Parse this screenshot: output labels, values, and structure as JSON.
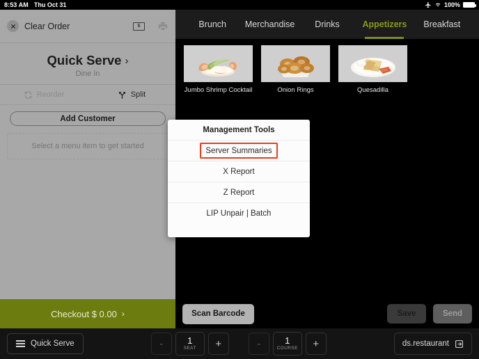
{
  "statusbar": {
    "time": "8:53 AM",
    "date": "Thu Oct 31",
    "battery_pct": "100%",
    "airplane_icon": "airplane-icon",
    "wifi_icon": "wifi-icon",
    "battery_icon": "battery-icon"
  },
  "order_panel": {
    "clear_order_label": "Clear Order",
    "close_icon": "close-x-icon",
    "cash_icon_label": "$",
    "cash_icon": "cash-drawer-icon",
    "print_icon": "printer-icon",
    "title": "Quick Serve",
    "title_chevron": "›",
    "subtitle": "Dine In",
    "reorder_label": "Reorder",
    "reorder_icon": "reorder-refresh-icon",
    "split_label": "Split",
    "split_icon": "split-branch-icon",
    "add_customer_label": "Add Customer",
    "empty_state": "Select a menu item to get started",
    "checkout_label": "Checkout $ 0.00",
    "checkout_chevron": "›",
    "checkout_color": "#6d7c0e"
  },
  "tabs": {
    "accent_color": "#8a9a16",
    "items": [
      {
        "label": "Brunch",
        "active": false
      },
      {
        "label": "Merchandise",
        "active": false
      },
      {
        "label": "Drinks",
        "active": false
      },
      {
        "label": "Appetizers",
        "active": true
      },
      {
        "label": "Breakfast",
        "active": false
      }
    ]
  },
  "menu_items": [
    {
      "label": "Jumbo Shrimp Cocktail",
      "image": "shrimp-cocktail-photo"
    },
    {
      "label": "Onion Rings",
      "image": "onion-rings-photo"
    },
    {
      "label": "Quesadilla",
      "image": "quesadilla-photo"
    }
  ],
  "modal": {
    "header": "Management Tools",
    "highlight_color": "#ea3c18",
    "items": [
      {
        "label": "Server Summaries",
        "selected": true
      },
      {
        "label": "X Report",
        "selected": false
      },
      {
        "label": "Z Report",
        "selected": false
      },
      {
        "label": "LIP Unpair | Batch",
        "selected": false
      }
    ]
  },
  "action_bar": {
    "scan_label": "Scan Barcode",
    "save_label": "Save",
    "send_label": "Send"
  },
  "bottom_bar": {
    "menu_icon": "hamburger-menu-icon",
    "order_type": "Quick Serve",
    "seat": {
      "minus": "-",
      "value": "1",
      "unit": "SEAT",
      "plus": "+"
    },
    "course": {
      "minus": "-",
      "value": "1",
      "unit": "COURSE",
      "plus": "+"
    },
    "account": "ds.restaurant",
    "account_icon": "logout-arrow-icon"
  }
}
